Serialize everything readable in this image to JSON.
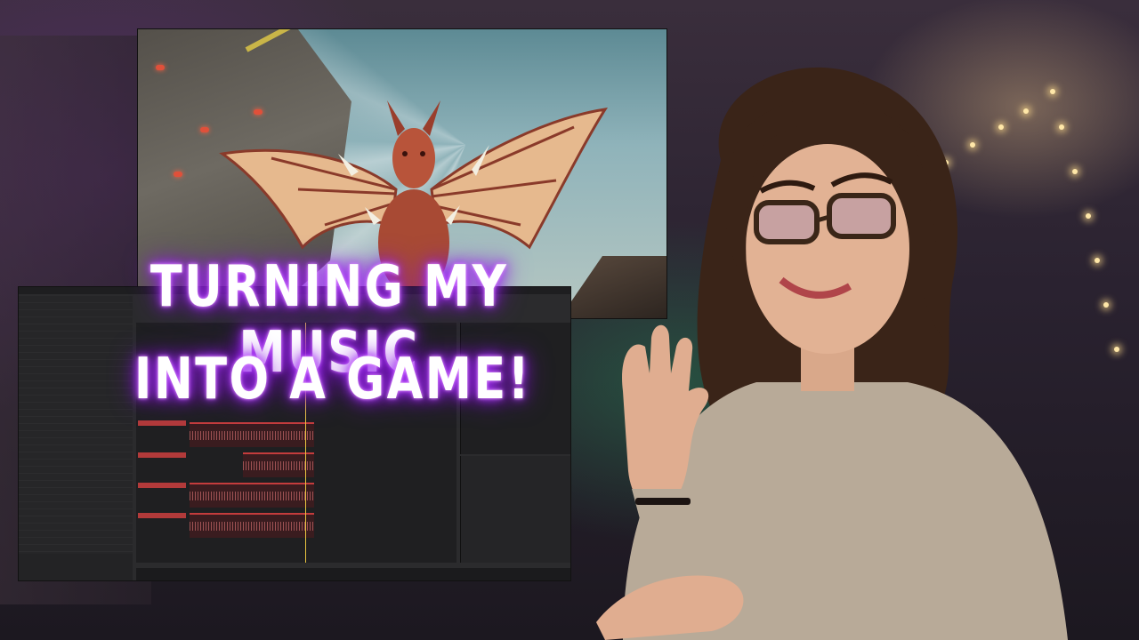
{
  "thumbnail": {
    "headline_line1": "TURNING MY MUSIC",
    "headline_line2": "INTO A GAME!",
    "glow_color": "#b040ff",
    "text_color": "#ffffff"
  },
  "scene": {
    "game_screenshot": "dragon-creature-icon",
    "daw_screenshot": "music-editor-window",
    "presenter": "person-waving"
  }
}
